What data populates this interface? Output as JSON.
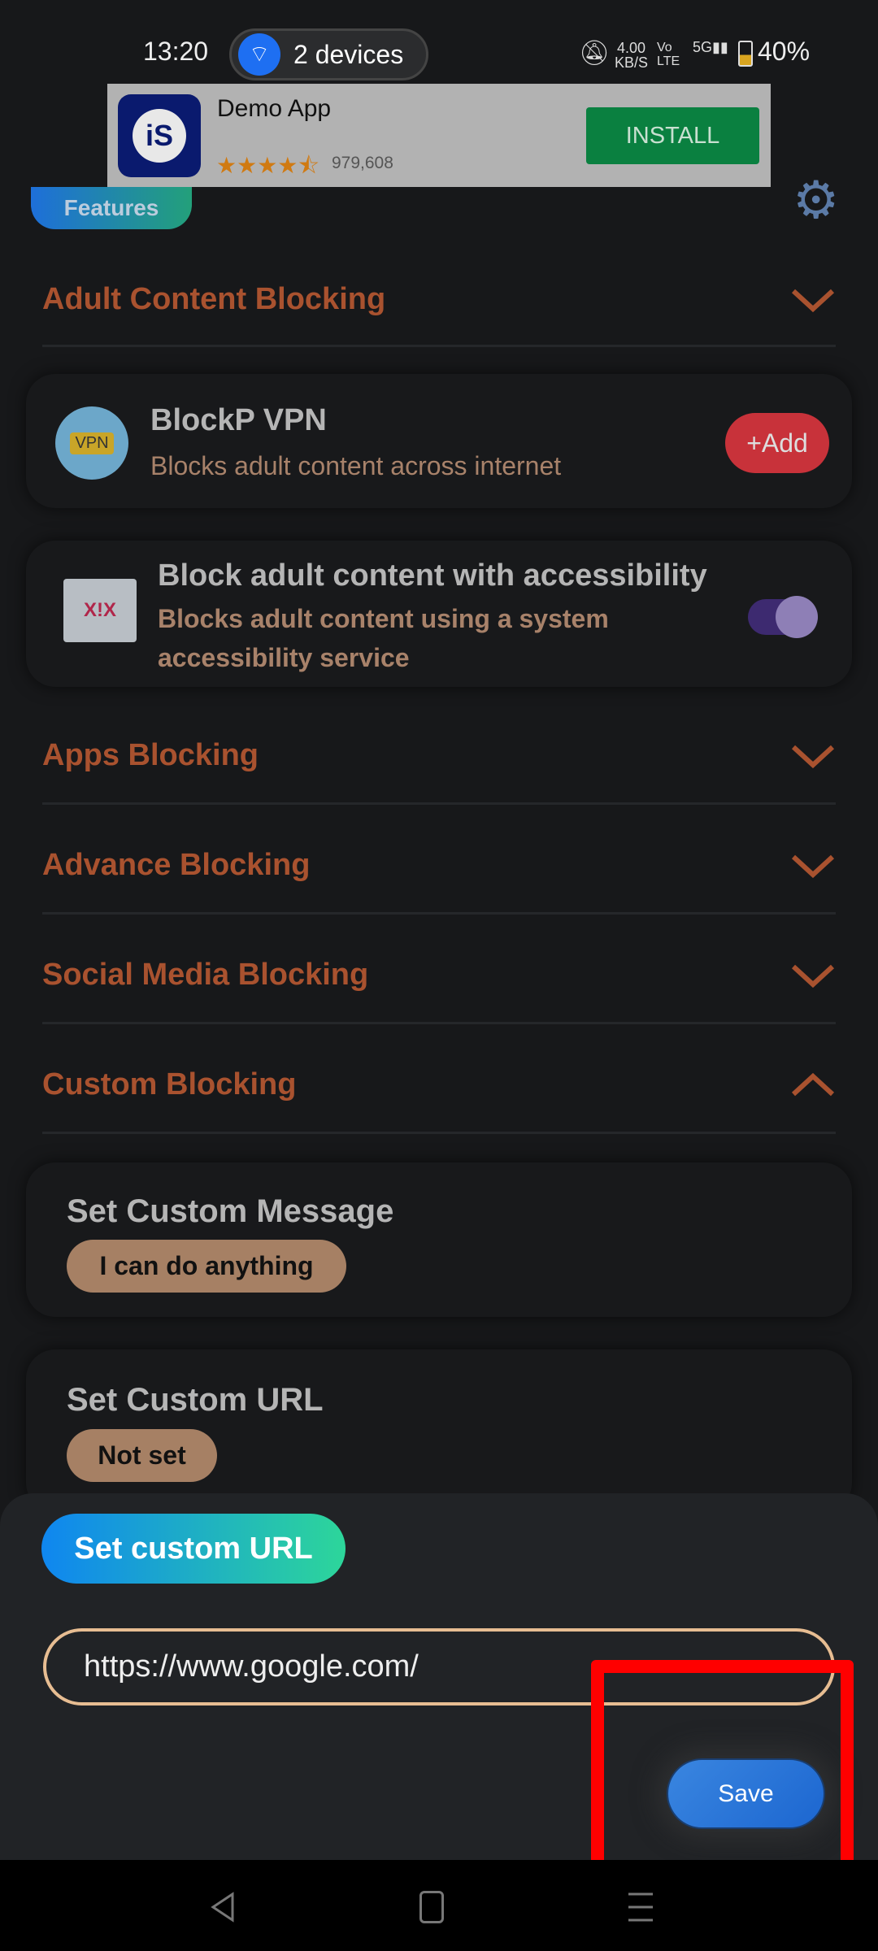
{
  "status_bar": {
    "time": "13:20",
    "hotspot": "2 devices",
    "speed": "4.00",
    "speed_unit": "KB/S",
    "network": "5G",
    "battery": "40%"
  },
  "ad": {
    "app_name": "Demo App",
    "rating": 4.5,
    "stars": "★★★★⯪",
    "reviews": "979,608",
    "install_label": "INSTALL"
  },
  "header": {
    "features_label": "Features"
  },
  "sections": [
    {
      "label": "Adult Content Blocking",
      "expanded": false
    },
    {
      "label": "Apps Blocking",
      "expanded": false
    },
    {
      "label": "Advance Blocking",
      "expanded": false
    },
    {
      "label": "Social Media Blocking",
      "expanded": false
    },
    {
      "label": "Custom Blocking",
      "expanded": true
    }
  ],
  "vpn_card": {
    "icon_text": "VPN",
    "title": "BlockP VPN",
    "subtitle": "Blocks adult content across internet",
    "add_label": "+Add"
  },
  "accessibility_card": {
    "title": "Block adult content with accessibility",
    "subtitle_line1": "Blocks adult content using a system",
    "subtitle_line2": "accessibility service",
    "toggle_on": true
  },
  "custom_message": {
    "title": "Set Custom Message",
    "value": "I can do anything"
  },
  "custom_url": {
    "title": "Set Custom URL",
    "value": "Not set"
  },
  "sheet": {
    "title": "Set custom URL",
    "input_value": "https://www.google.com/",
    "save_label": "Save"
  },
  "colors": {
    "section": "#a9522f",
    "accent_blue": "#1e6fd9",
    "add_red": "#c8323a",
    "highlight": "#ff0000"
  }
}
